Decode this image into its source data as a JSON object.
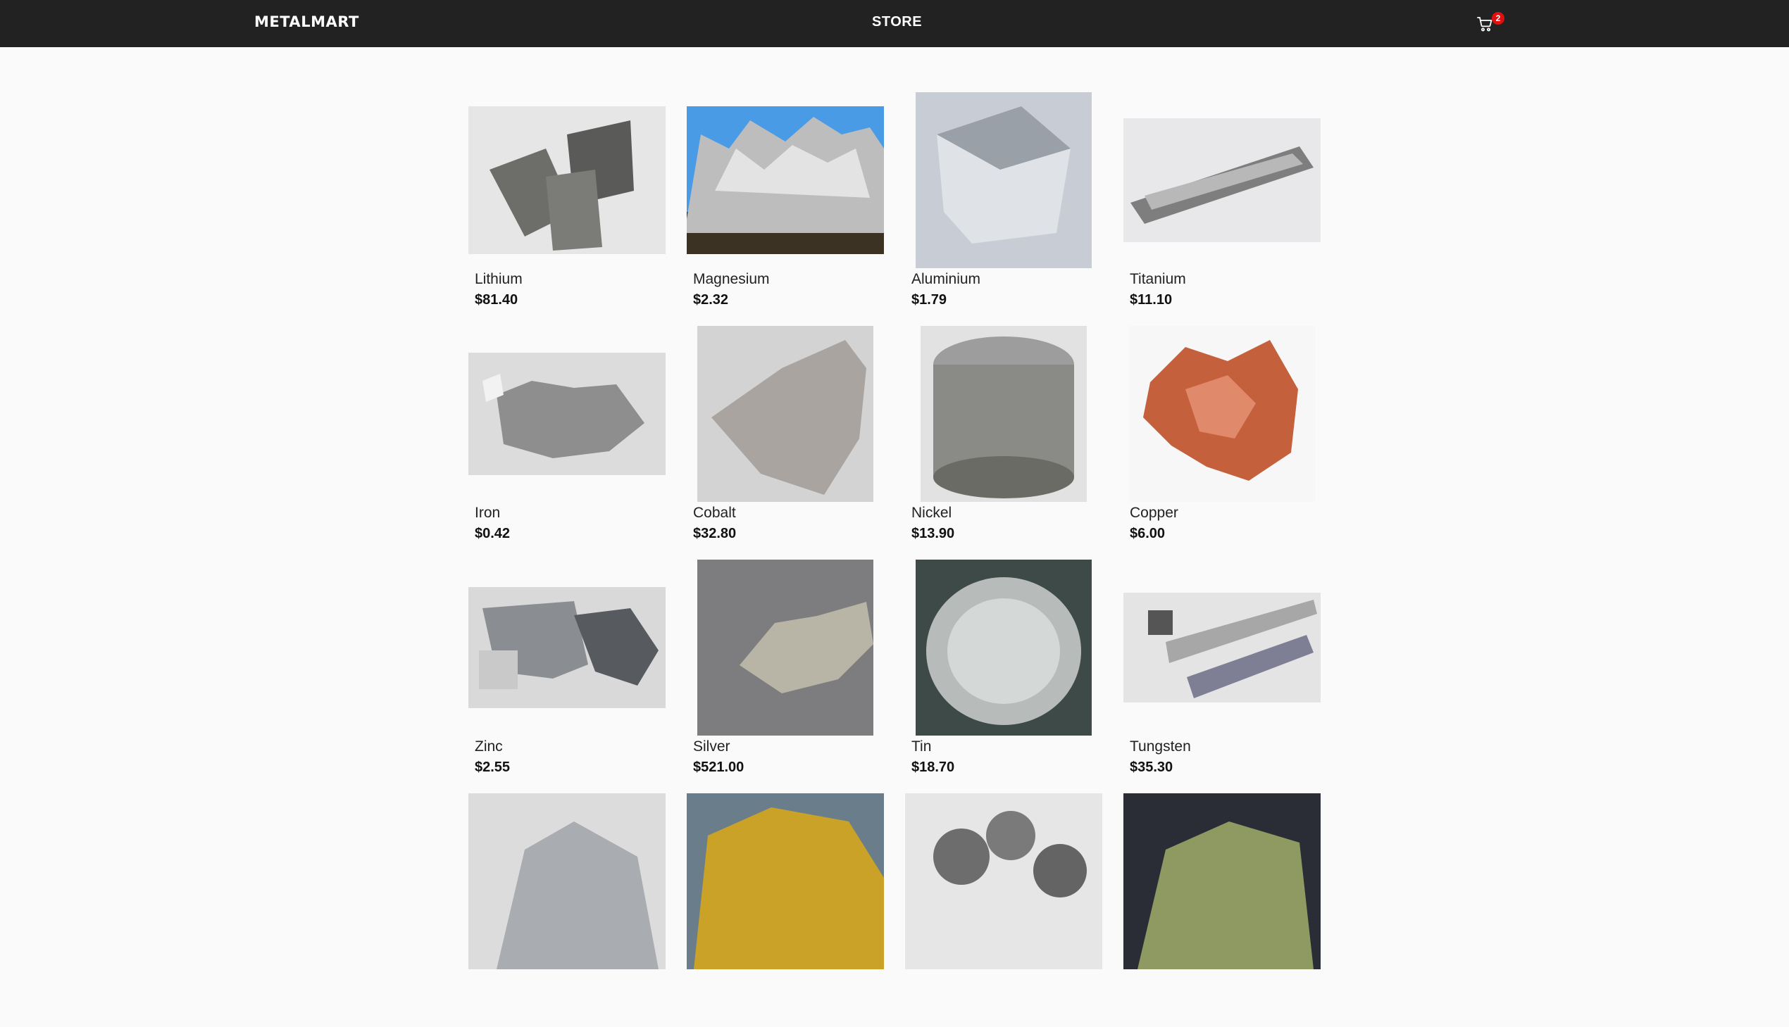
{
  "header": {
    "logo": "METALMART",
    "nav_store": "STORE",
    "cart_count": "2",
    "cart_icon": "cart-icon"
  },
  "products": [
    {
      "name": "Lithium",
      "price": "$81.40",
      "image": "lithium-image"
    },
    {
      "name": "Magnesium",
      "price": "$2.32",
      "image": "magnesium-image"
    },
    {
      "name": "Aluminium",
      "price": "$1.79",
      "image": "aluminium-image"
    },
    {
      "name": "Titanium",
      "price": "$11.10",
      "image": "titanium-image"
    },
    {
      "name": "Iron",
      "price": "$0.42",
      "image": "iron-image"
    },
    {
      "name": "Cobalt",
      "price": "$32.80",
      "image": "cobalt-image"
    },
    {
      "name": "Nickel",
      "price": "$13.90",
      "image": "nickel-image"
    },
    {
      "name": "Copper",
      "price": "$6.00",
      "image": "copper-image"
    },
    {
      "name": "Zinc",
      "price": "$2.55",
      "image": "zinc-image"
    },
    {
      "name": "Silver",
      "price": "$521.00",
      "image": "silver-image"
    },
    {
      "name": "Tin",
      "price": "$18.70",
      "image": "tin-image"
    },
    {
      "name": "Tungsten",
      "price": "$35.30",
      "image": "tungsten-image"
    },
    {
      "name": "",
      "price": "",
      "image": "bismuth-image"
    },
    {
      "name": "",
      "price": "",
      "image": "gold-image"
    },
    {
      "name": "",
      "price": "",
      "image": "lead-image"
    },
    {
      "name": "",
      "price": "",
      "image": "uranium-image"
    }
  ],
  "colors": {
    "header_bg": "#222222",
    "page_bg": "#fafafa",
    "badge_bg": "#e01010"
  }
}
